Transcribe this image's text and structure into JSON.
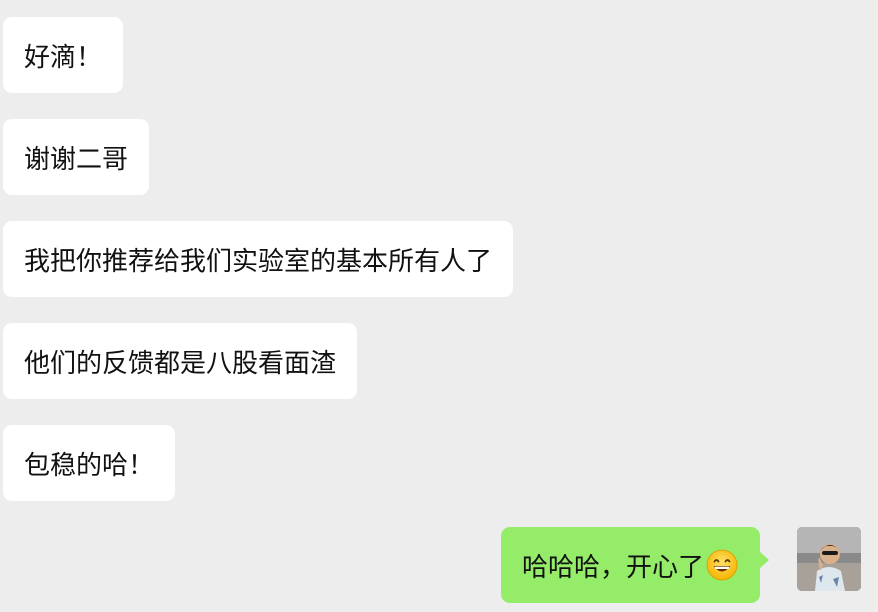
{
  "chat": {
    "incoming": [
      "好滴！",
      "谢谢二哥",
      "我把你推荐给我们实验室的基本所有人了",
      "他们的反馈都是八股看面渣",
      "包稳的哈！"
    ],
    "outgoing": {
      "text": "哈哈哈，开心了",
      "emoji": "grinning-face-emoji"
    }
  },
  "colors": {
    "background": "#ededed",
    "incoming_bubble": "#ffffff",
    "outgoing_bubble": "#95ec69",
    "text": "#111111"
  }
}
